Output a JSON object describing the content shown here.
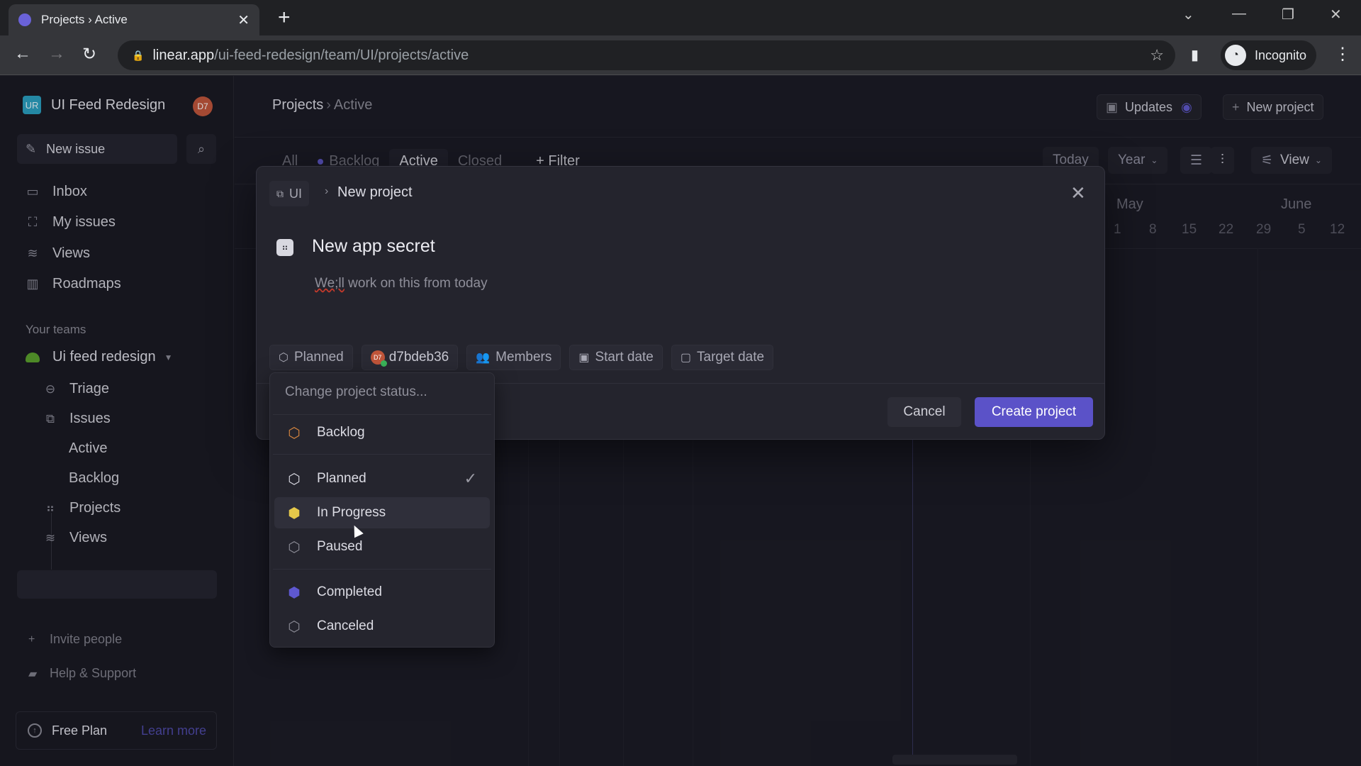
{
  "browser": {
    "tab_title": "Projects › Active",
    "url_host": "linear.app",
    "url_path": "/ui-feed-redesign/team/UI/projects/active",
    "profile_label": "Incognito"
  },
  "sidebar": {
    "workspace_logo": "UR",
    "workspace_name": "UI Feed Redesign",
    "user_initials": "D7",
    "new_issue_label": "New issue",
    "nav": [
      {
        "label": "Inbox",
        "icon": "inbox-icon"
      },
      {
        "label": "My issues",
        "icon": "my-issues-icon"
      },
      {
        "label": "Views",
        "icon": "views-icon"
      },
      {
        "label": "Roadmaps",
        "icon": "roadmap-icon"
      }
    ],
    "teams_label": "Your teams",
    "team_name": "Ui feed redesign",
    "team_items": [
      {
        "label": "Triage",
        "icon": "triage-icon"
      },
      {
        "label": "Issues",
        "icon": "issues-icon"
      },
      {
        "label": "Active",
        "icon": ""
      },
      {
        "label": "Backlog",
        "icon": ""
      },
      {
        "label": "Projects",
        "icon": "projects-icon"
      },
      {
        "label": "Views",
        "icon": "views-icon"
      }
    ],
    "invite_label": "Invite people",
    "help_label": "Help & Support",
    "plan_label": "Free Plan",
    "learn_more": "Learn more"
  },
  "main": {
    "breadcrumb_root": "Projects",
    "breadcrumb_current": "Active",
    "updates_label": "Updates",
    "new_project_label": "New project",
    "filter_tabs": [
      "All",
      "Backlog",
      "Active",
      "Closed"
    ],
    "active_filter": "Active",
    "filter_label": "Filter",
    "today_label": "Today",
    "zoom_select": "Year",
    "view_label": "View",
    "months": [
      "May",
      "June"
    ],
    "days": [
      "1",
      "8",
      "15",
      "22",
      "29",
      "5",
      "12"
    ]
  },
  "modal": {
    "team_chip": "UI",
    "crumb": "New project",
    "project_name": "New app secret",
    "description_misspelled": "We;ll",
    "description_rest": " work on this from today",
    "chips": {
      "status": "Planned",
      "lead": "d7bdeb36",
      "lead_initials": "D7",
      "members": "Members",
      "start_date": "Start date",
      "target_date": "Target date"
    },
    "cancel_label": "Cancel",
    "create_label": "Create project"
  },
  "status_menu": {
    "placeholder": "Change project status...",
    "items": [
      {
        "label": "Backlog",
        "color": "#d9873f",
        "selected": false
      },
      {
        "label": "Planned",
        "color": "#d8d8e0",
        "selected": true
      },
      {
        "label": "In Progress",
        "color": "#e5c84a",
        "selected": false,
        "hovered": true
      },
      {
        "label": "Paused",
        "color": "#8a8a94",
        "selected": false
      },
      {
        "label": "Completed",
        "color": "#5e58d0",
        "selected": false
      },
      {
        "label": "Canceled",
        "color": "#8a8a94",
        "selected": false
      }
    ],
    "check": "✓"
  },
  "colors": {
    "accent": "#5b52c8"
  }
}
